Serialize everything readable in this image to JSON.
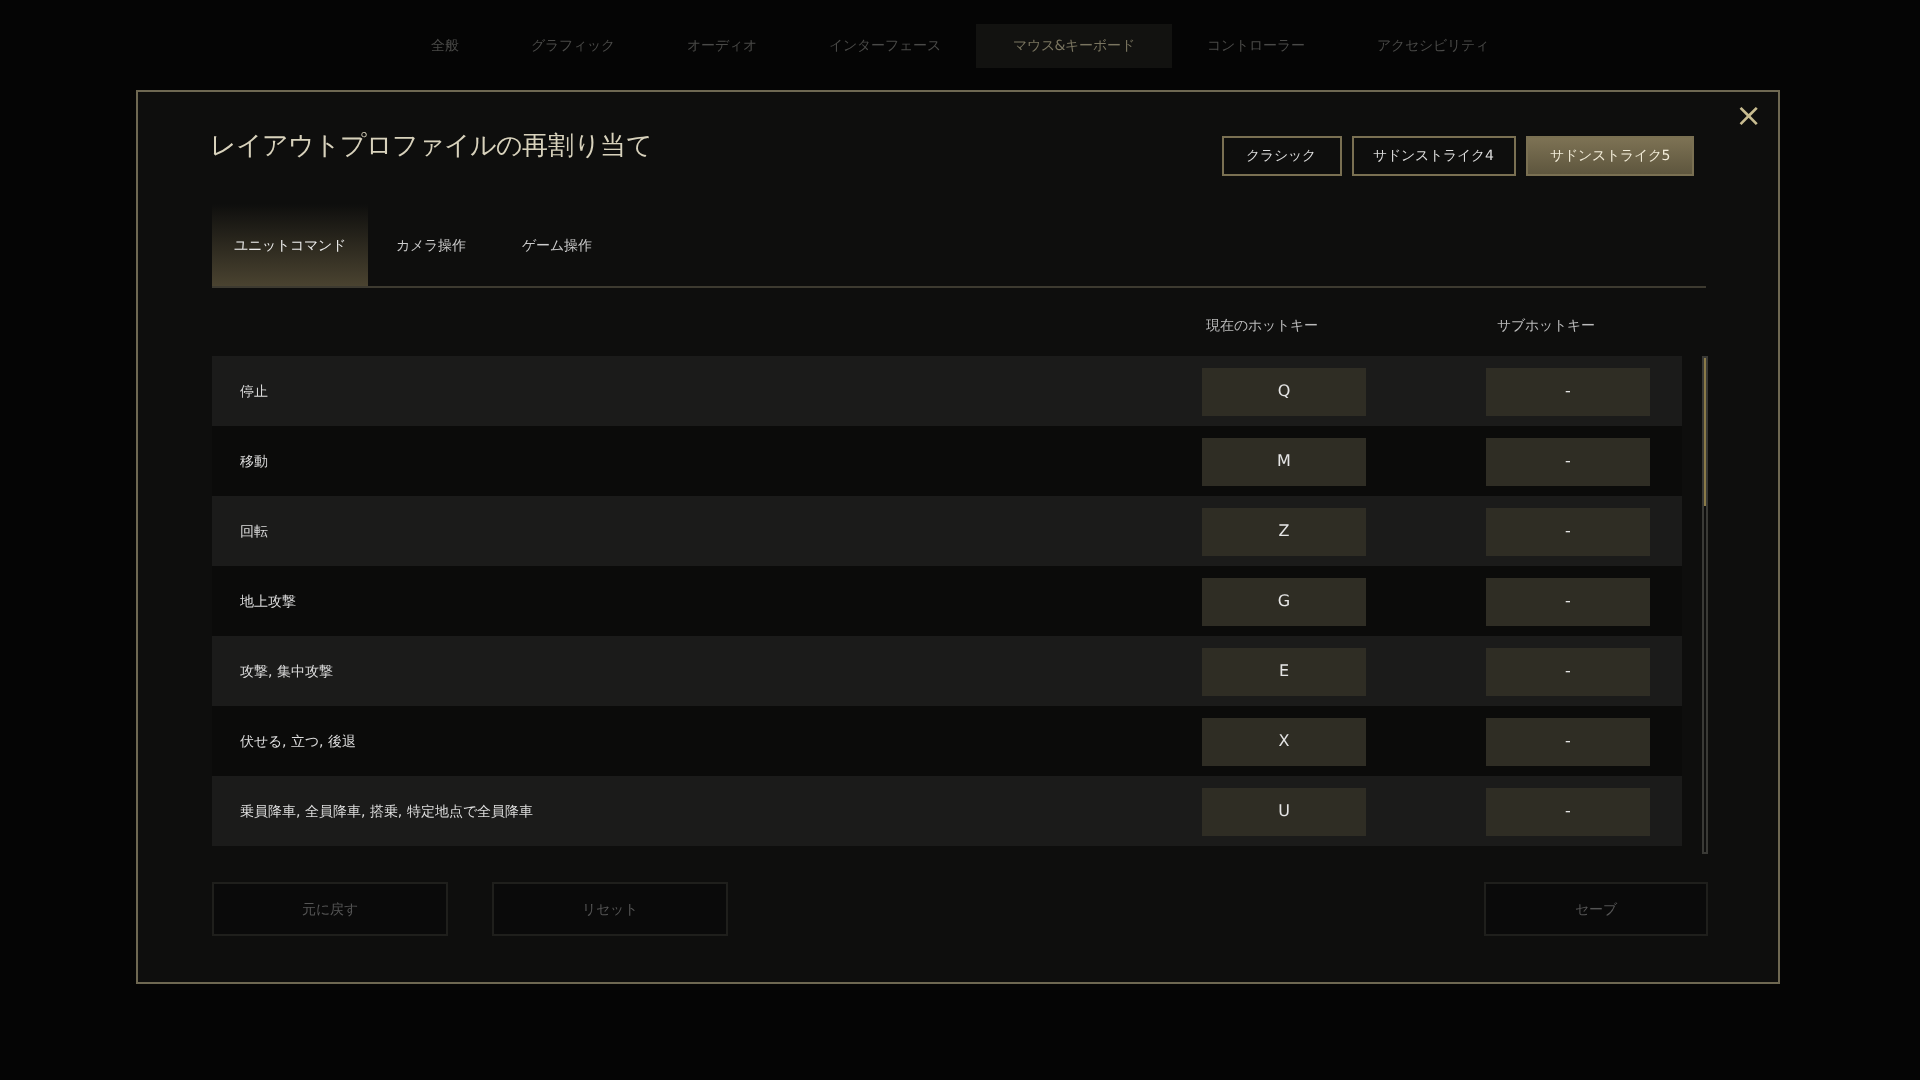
{
  "top_nav": [
    {
      "label": "全般",
      "selected": false
    },
    {
      "label": "グラフィック",
      "selected": false
    },
    {
      "label": "オーディオ",
      "selected": false
    },
    {
      "label": "インターフェース",
      "selected": false
    },
    {
      "label": "マウス&キーボード",
      "selected": true
    },
    {
      "label": "コントローラー",
      "selected": false
    },
    {
      "label": "アクセシビリティ",
      "selected": false
    }
  ],
  "dialog": {
    "title": "レイアウトプロファイルの再割り当て",
    "close": "×",
    "profiles": [
      {
        "label": "クラシック",
        "selected": false
      },
      {
        "label": "サドンストライク4",
        "selected": false
      },
      {
        "label": "サドンストライク5",
        "selected": true
      }
    ],
    "tabs": [
      {
        "label": "ユニットコマンド",
        "selected": true
      },
      {
        "label": "カメラ操作",
        "selected": false
      },
      {
        "label": "ゲーム操作",
        "selected": false
      }
    ],
    "columns": [
      "現在のホットキー",
      "サブホットキー"
    ],
    "rows": [
      {
        "action": "停止",
        "hotkey": "Q",
        "sub_hotkey": "-"
      },
      {
        "action": "移動",
        "hotkey": "M",
        "sub_hotkey": "-"
      },
      {
        "action": "回転",
        "hotkey": "Z",
        "sub_hotkey": "-"
      },
      {
        "action": "地上攻撃",
        "hotkey": "G",
        "sub_hotkey": "-"
      },
      {
        "action": "攻撃, 集中攻撃",
        "hotkey": "E",
        "sub_hotkey": "-"
      },
      {
        "action": "伏せる, 立つ, 後退",
        "hotkey": "X",
        "sub_hotkey": "-"
      },
      {
        "action": "乗員降車, 全員降車, 搭乗, 特定地点で全員降車",
        "hotkey": "U",
        "sub_hotkey": "-"
      }
    ],
    "buttons": [
      {
        "label": "元に戻す",
        "disabled": true
      },
      {
        "label": "リセット",
        "disabled": true
      },
      {
        "label": "セーブ",
        "disabled": true
      }
    ]
  }
}
